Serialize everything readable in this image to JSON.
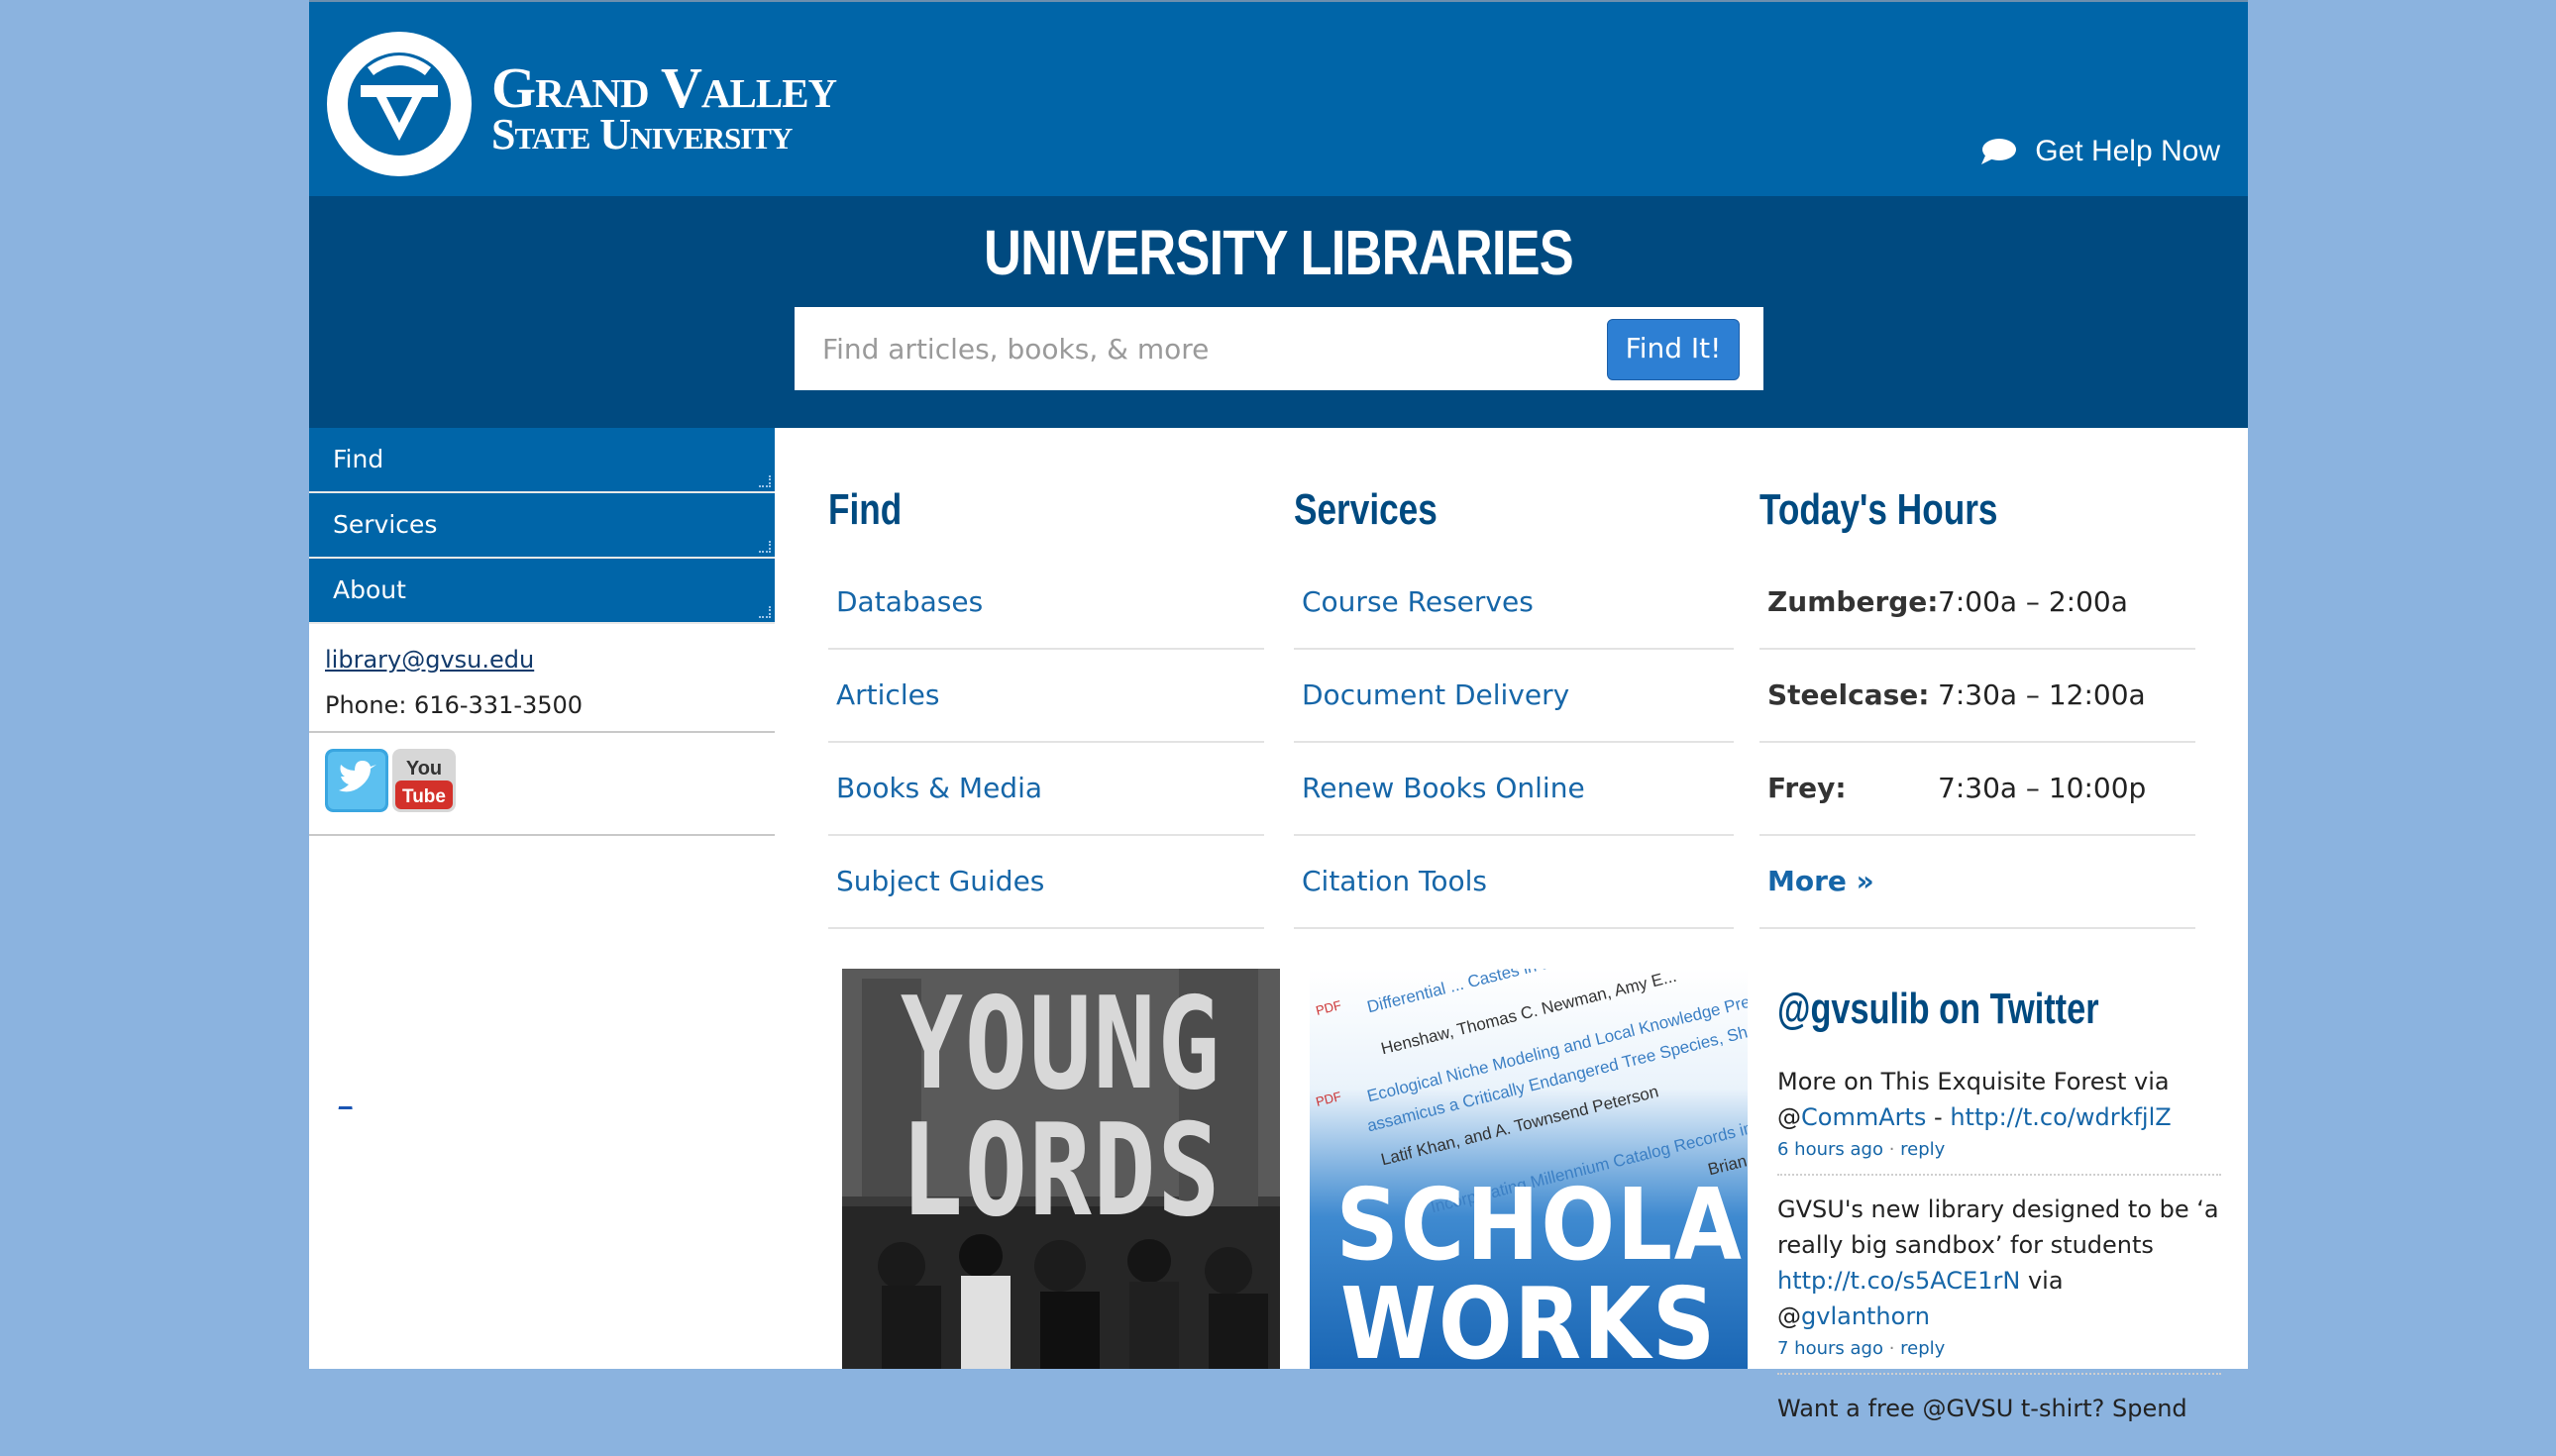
{
  "header": {
    "logo_line1": "Grand Valley",
    "logo_line2": "State University",
    "help_label": "Get Help Now"
  },
  "banner": {
    "title": "UNIVERSITY LIBRARIES",
    "search_placeholder": "Find articles, books, & more",
    "search_button": "Find It!"
  },
  "sidebar": {
    "nav": [
      "Find",
      "Services",
      "About"
    ],
    "email": "library@gvsu.edu",
    "phone": "Phone: 616-331-3500",
    "tiny_link": "_"
  },
  "find": {
    "heading": "Find",
    "items": [
      "Databases",
      "Articles",
      "Books & Media",
      "Subject Guides"
    ]
  },
  "services": {
    "heading": "Services",
    "items": [
      "Course Reserves",
      "Document Delivery",
      "Renew Books Online",
      "Citation Tools"
    ]
  },
  "hours": {
    "heading": "Today's Hours",
    "rows": [
      {
        "loc": "Zumberge:",
        "time": "7:00a – 2:00a"
      },
      {
        "loc": "Steelcase:",
        "time": "7:30a – 12:00a"
      },
      {
        "loc": "Frey:",
        "time": "7:30a – 10:00p"
      }
    ],
    "more": "More »"
  },
  "promos": {
    "young_line1": "YOUNG",
    "young_line2": "LORDS",
    "sw_line1": "SCHOLAR",
    "sw_line2": "WORKS",
    "sw_snippets": [
      "Differential ... Castes in a Primitively E...",
      "Henshaw, Thomas C. Newman, Amy E...",
      "Ecological Niche Modeling and Local Knowledge Predict N",
      "assamicus a Critically Endangered Tree Species, Shally",
      "Latif Khan, and A. Townsend Peterson",
      "Incorporating Millennium Catalog Records into S",
      "Brian F"
    ],
    "pdf_label": "PDF"
  },
  "twitter": {
    "heading": "@gvsulib on Twitter",
    "tweets": [
      {
        "pre": "More on This Exquisite Forest via @",
        "handle": "CommArts",
        "mid": " - ",
        "link": "http://t.co/wdrkfjlZ",
        "post": "",
        "time": "6 hours ago",
        "reply": "reply"
      },
      {
        "pre": "GVSU's new library designed to be ‘a really big sandbox’ for students ",
        "handle": "",
        "mid": "",
        "link": "http://t.co/s5ACE1rN",
        "post": " via @",
        "handle2": "gvlanthorn",
        "time": "7 hours ago",
        "reply": "reply"
      }
    ],
    "partial": "Want a free @GVSU t-shirt? Spend"
  },
  "colors": {
    "page_bg": "#8bb3df",
    "header_blue": "#0065a8",
    "banner_blue": "#004a80",
    "link_blue": "#1666a8"
  }
}
